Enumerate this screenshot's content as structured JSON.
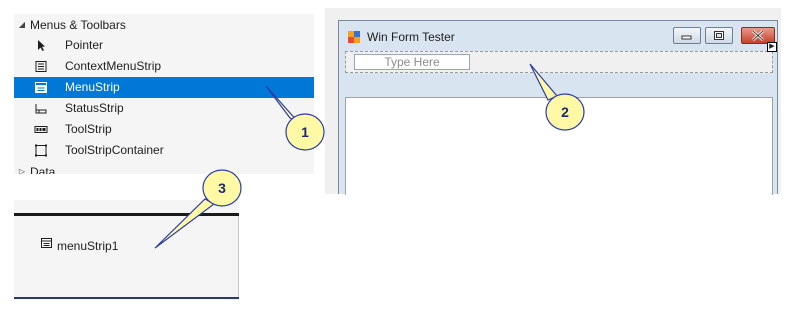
{
  "toolbox": {
    "category_menus": {
      "label": "Menus & Toolbars",
      "expanded": true
    },
    "items": [
      {
        "label": "Pointer",
        "icon": "pointer-arrow-icon",
        "selected": false
      },
      {
        "label": "ContextMenuStrip",
        "icon": "context-menu-strip-icon",
        "selected": false
      },
      {
        "label": "MenuStrip",
        "icon": "menu-strip-icon",
        "selected": true
      },
      {
        "label": "StatusStrip",
        "icon": "status-strip-icon",
        "selected": false
      },
      {
        "label": "ToolStrip",
        "icon": "tool-strip-icon",
        "selected": false
      },
      {
        "label": "ToolStripContainer",
        "icon": "tool-strip-container-icon",
        "selected": false
      }
    ],
    "category_data": {
      "label": "Data",
      "expanded": false
    }
  },
  "form": {
    "title": "Win Form Tester",
    "menu_placeholder": "Type Here"
  },
  "tray": {
    "component_label": "menuStrip1"
  },
  "callouts": [
    "1",
    "2",
    "3"
  ],
  "colors": {
    "selection": "#0078d7",
    "callout_fill": "#fff9a6",
    "callout_stroke": "#2a3ca8",
    "close_button": "#c6402b"
  }
}
